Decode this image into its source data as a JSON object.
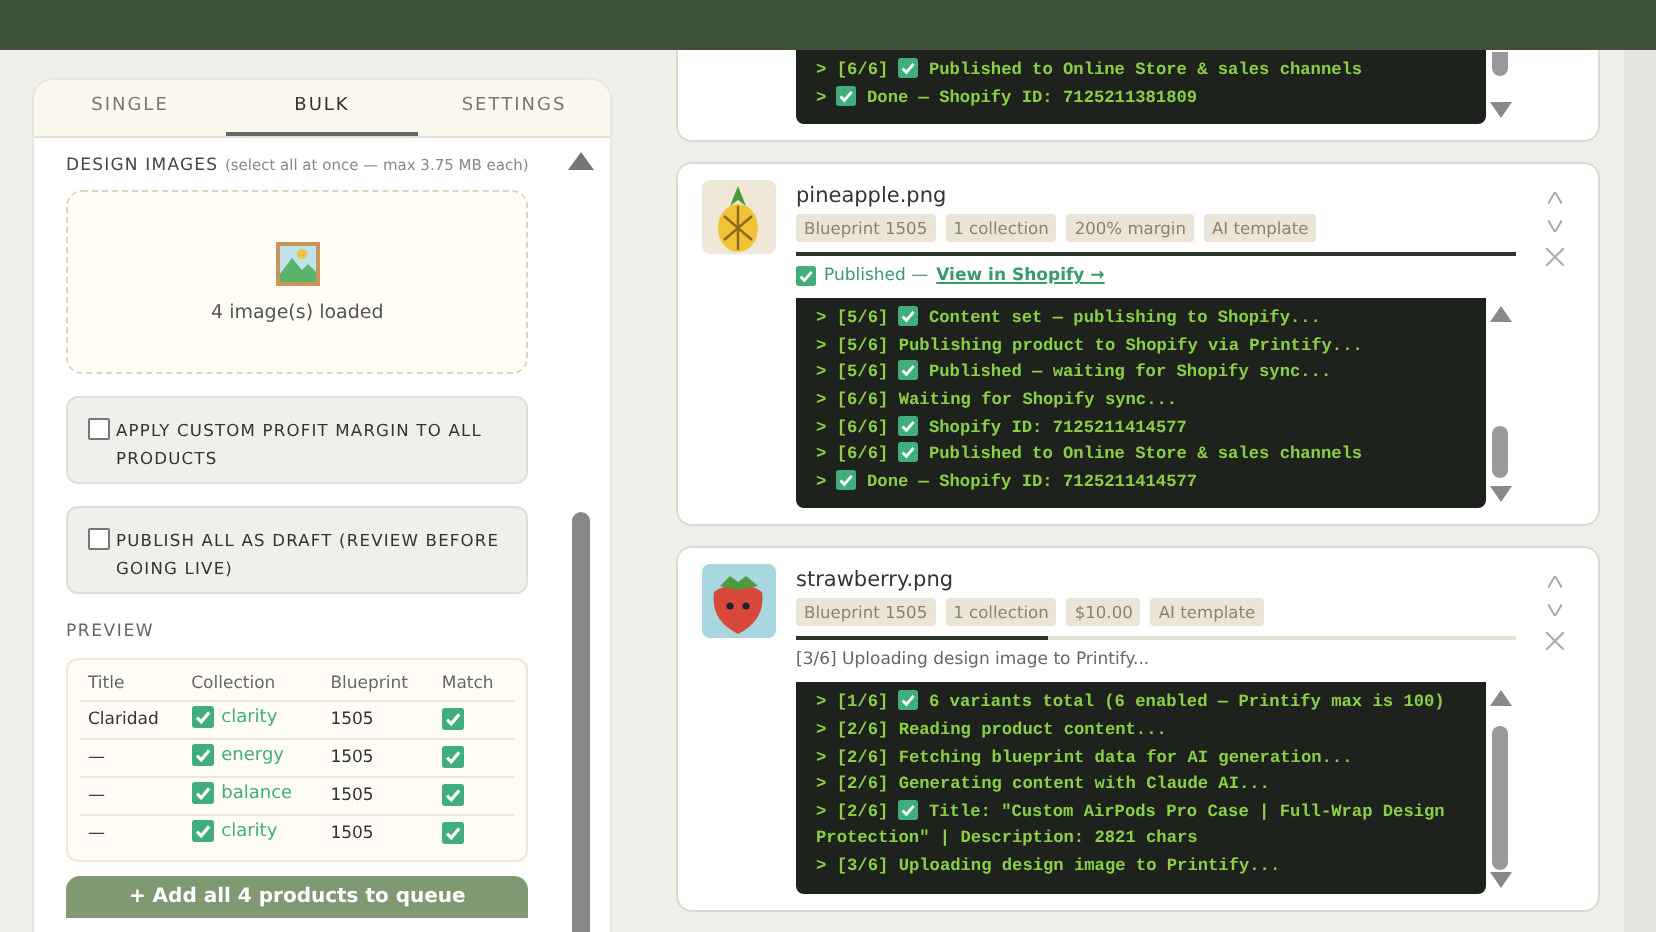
{
  "tabs": [
    {
      "label": "SINGLE",
      "selected": false
    },
    {
      "label": "BULK",
      "selected": true
    },
    {
      "label": "SETTINGS",
      "selected": false
    }
  ],
  "design_images": {
    "label": "DESIGN IMAGES",
    "hint": "(select all at once — max 3.75 MB each)",
    "status": "4 image(s) loaded"
  },
  "options": [
    {
      "label": "APPLY CUSTOM PROFIT MARGIN TO ALL PRODUCTS",
      "checked": false
    },
    {
      "label": "PUBLISH ALL AS DRAFT (REVIEW BEFORE GOING LIVE)",
      "checked": false
    }
  ],
  "preview": {
    "label": "PREVIEW",
    "columns": [
      "Title",
      "Collection",
      "Blueprint",
      "Match"
    ],
    "rows": [
      {
        "title": "Claridad",
        "collection": "clarity",
        "collection_checked": true,
        "blueprint": "1505",
        "match": true
      },
      {
        "title": "—",
        "collection": "energy",
        "collection_checked": true,
        "blueprint": "1505",
        "match": true
      },
      {
        "title": "—",
        "collection": "balance",
        "collection_checked": true,
        "blueprint": "1505",
        "match": true
      },
      {
        "title": "—",
        "collection": "clarity",
        "collection_checked": true,
        "blueprint": "1505",
        "match": true
      }
    ]
  },
  "add_button": "+ Add all 4 products to queue",
  "jobs": [
    {
      "lines": [
        {
          "prompt": ">",
          "step": "[6/6]",
          "ok": true,
          "text": "Published to Online Store & sales channels"
        },
        {
          "prompt": ">",
          "ok": true,
          "text": "Done — Shopify ID: 7125211381809"
        }
      ]
    },
    {
      "file": "pineapple.png",
      "chips": [
        "Blueprint 1505",
        "1 collection",
        "200% margin",
        "AI template"
      ],
      "progress": {
        "level": 1
      },
      "status": {
        "kind": "published",
        "label": "Published —",
        "link": "View in Shopify →"
      },
      "lines": [
        {
          "prompt": ">",
          "step": "[5/6]",
          "ok": true,
          "text": "Content set — publishing to Shopify..."
        },
        {
          "prompt": ">",
          "step": "[5/6]",
          "ok": false,
          "text": "Publishing product to Shopify via Printify..."
        },
        {
          "prompt": ">",
          "step": "[5/6]",
          "ok": true,
          "text": "Published — waiting for Shopify sync..."
        },
        {
          "prompt": ">",
          "step": "[6/6]",
          "ok": false,
          "text": "Waiting for Shopify sync..."
        },
        {
          "prompt": ">",
          "step": "[6/6]",
          "ok": true,
          "text": "Shopify ID: 7125211414577"
        },
        {
          "prompt": ">",
          "step": "[6/6]",
          "ok": true,
          "text": "Published to Online Store & sales channels"
        },
        {
          "prompt": ">",
          "ok": true,
          "text": "Done — Shopify ID: 7125211414577"
        }
      ]
    },
    {
      "file": "strawberry.png",
      "chips": [
        "Blueprint 1505",
        "1 collection",
        "$10.00",
        "AI template"
      ],
      "progress": {
        "level": 0.35
      },
      "status": {
        "kind": "progress",
        "label": "[3/6] Uploading design image to Printify..."
      },
      "lines": [
        {
          "prompt": ">",
          "step": "[1/6]",
          "ok": true,
          "text": "6 variants total (6 enabled — Printify max is 100)"
        },
        {
          "prompt": ">",
          "step": "[2/6]",
          "ok": false,
          "text": "Reading product content..."
        },
        {
          "prompt": ">",
          "step": "[2/6]",
          "ok": false,
          "text": "Fetching blueprint data for AI generation..."
        },
        {
          "prompt": ">",
          "step": "[2/6]",
          "ok": false,
          "text": "Generating content with Claude AI..."
        },
        {
          "prompt": ">",
          "step": "[2/6]",
          "ok": true,
          "text": "Title: \"Custom AirPods Pro Case | Full-Wrap Design Protection\" | Description: 2821 chars"
        },
        {
          "prompt": ">",
          "step": "[3/6]",
          "ok": false,
          "text": "Uploading design image to Printify..."
        }
      ]
    }
  ]
}
